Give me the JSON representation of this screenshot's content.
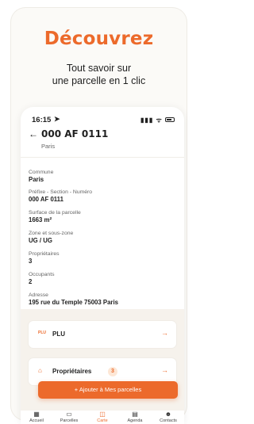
{
  "hero": {
    "title": "Découvrez",
    "subtitle_line1": "Tout savoir sur",
    "subtitle_line2": "une parcelle en 1 clic"
  },
  "status": {
    "time": "16:15",
    "location_arrow": "➤",
    "signal": "▮▮▮ ᯤ"
  },
  "parcel": {
    "back": "←",
    "title": "000 AF 0111",
    "city": "Paris"
  },
  "fields": [
    {
      "label": "Commune",
      "value": "Paris"
    },
    {
      "label": "Préfixe - Section - Numéro",
      "value": "000 AF 0111"
    },
    {
      "label": "Surface de la parcelle",
      "value": "1663 m²"
    },
    {
      "label": "Zone et sous-zone",
      "value": "UG / UG"
    },
    {
      "label": "Propriétaires",
      "value": "3"
    },
    {
      "label": "Occupants",
      "value": "2"
    },
    {
      "label": "Adresse",
      "value": "195 rue du Temple 75003 Paris"
    }
  ],
  "rows": [
    {
      "icon": "PLU",
      "label": "PLU",
      "arrow": "→"
    },
    {
      "icon": "⌂",
      "label": "Propriétaires",
      "badge": "3",
      "arrow": "→"
    }
  ],
  "cta": {
    "label": "+ Ajouter à Mes parcelles"
  },
  "tabs": [
    {
      "icon": "▦",
      "label": "Accueil"
    },
    {
      "icon": "▭",
      "label": "Parcelles"
    },
    {
      "icon": "◫",
      "label": "Carte"
    },
    {
      "icon": "▤",
      "label": "Agenda"
    },
    {
      "icon": "☻",
      "label": "Contacts"
    }
  ],
  "colors": {
    "accent": "#ec6a2b",
    "background": "#fbfaf7"
  }
}
